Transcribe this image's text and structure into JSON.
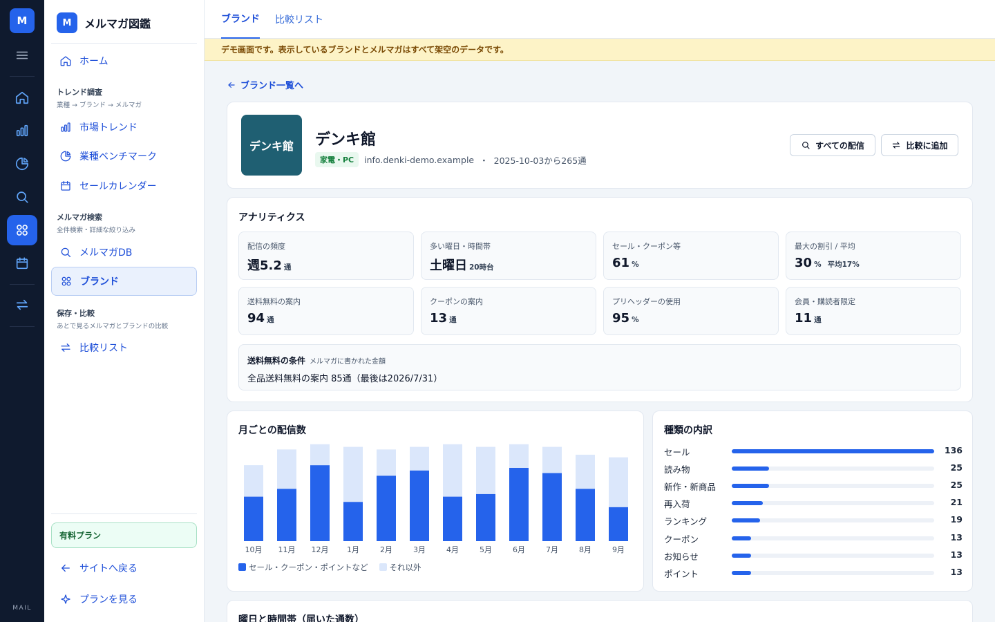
{
  "rail": {
    "logo": "M",
    "footer": "MAIL"
  },
  "sidebar": {
    "app_icon": "M",
    "app_name": "メルマガ図鑑",
    "home": "ホーム",
    "sections": [
      {
        "title": "トレンド調査",
        "subtitle": "業種 → ブランド → メルマガ"
      },
      {
        "title": "メルマガ検索",
        "subtitle": "全件検索・詳細な絞り込み"
      },
      {
        "title": "保存・比較",
        "subtitle": "あとで見るメルマガとブランドの比較"
      }
    ],
    "items": {
      "market_trend": "市場トレンド",
      "industry_benchmark": "業種ベンチマーク",
      "sale_calendar": "セールカレンダー",
      "mailmag_db": "メルマガDB",
      "brand": "ブランド",
      "compare_list": "比較リスト"
    },
    "paid_plan": "有料プラン",
    "back_to_site": "サイトへ戻る",
    "see_plans": "プランを見る"
  },
  "tabs": [
    "ブランド",
    "比較リスト"
  ],
  "notice": "デモ画面です。表示しているブランドとメルマガはすべて架空のデータです。",
  "back_link": "ブランド一覧へ",
  "brand": {
    "logo_text": "デンキ館",
    "name": "デンキ館",
    "category": "家電・PC",
    "email": "info.denki-demo.example",
    "dot": "・",
    "since": "2025-10-03から265通",
    "all_mails_button": "すべての配信",
    "add_compare_button": "比較に追加"
  },
  "analytics": {
    "title": "アナリティクス",
    "metrics": [
      {
        "label": "配信の頻度",
        "value": "週5.2",
        "unit": "通",
        "extra": ""
      },
      {
        "label": "多い曜日・時間帯",
        "value": "土曜日",
        "unit": "20時台",
        "extra": ""
      },
      {
        "label": "セール・クーポン等",
        "value": "61",
        "unit": "%",
        "extra": ""
      },
      {
        "label": "最大の割引 / 平均",
        "value": "30",
        "unit": "%",
        "extra": "平均17%"
      },
      {
        "label": "送料無料の案内",
        "value": "94",
        "unit": "通",
        "extra": ""
      },
      {
        "label": "クーポンの案内",
        "value": "13",
        "unit": "通",
        "extra": ""
      },
      {
        "label": "プリヘッダーの使用",
        "value": "95",
        "unit": "%",
        "extra": ""
      },
      {
        "label": "会員・購読者限定",
        "value": "11",
        "unit": "通",
        "extra": ""
      }
    ],
    "shipping": {
      "label": "送料無料の条件",
      "note": "メルマガに書かれた金額",
      "value": "全品送料無料の案内 85通（最後は2026/7/31）"
    }
  },
  "monthly": {
    "title": "月ごとの配信数"
  },
  "chart_data": {
    "type": "bar",
    "stacked": true,
    "categories": [
      "10月",
      "11月",
      "12月",
      "1月",
      "2月",
      "3月",
      "4月",
      "5月",
      "6月",
      "7月",
      "8月",
      "9月"
    ],
    "series": [
      {
        "name": "セール・クーポン・ポイントなど",
        "color": "#2563eb",
        "values": [
          17,
          20,
          29,
          15,
          25,
          27,
          17,
          18,
          28,
          26,
          20,
          13
        ]
      },
      {
        "name": "それ以外",
        "color": "#dbe7fb",
        "values": [
          12,
          15,
          8,
          21,
          10,
          9,
          20,
          18,
          9,
          10,
          13,
          19
        ]
      }
    ],
    "ylim": [
      0,
      38
    ],
    "grid": false,
    "legend": "bottom-left"
  },
  "breakdown": {
    "title": "種類の内訳",
    "max": 136,
    "rows": [
      {
        "label": "セール",
        "value": 136
      },
      {
        "label": "読み物",
        "value": 25
      },
      {
        "label": "新作・新商品",
        "value": 25
      },
      {
        "label": "再入荷",
        "value": 21
      },
      {
        "label": "ランキング",
        "value": 19
      },
      {
        "label": "クーポン",
        "value": 13
      },
      {
        "label": "お知らせ",
        "value": 13
      },
      {
        "label": "ポイント",
        "value": 13
      }
    ]
  },
  "weekday": {
    "title": "曜日と時間帯（届いた通数）"
  }
}
